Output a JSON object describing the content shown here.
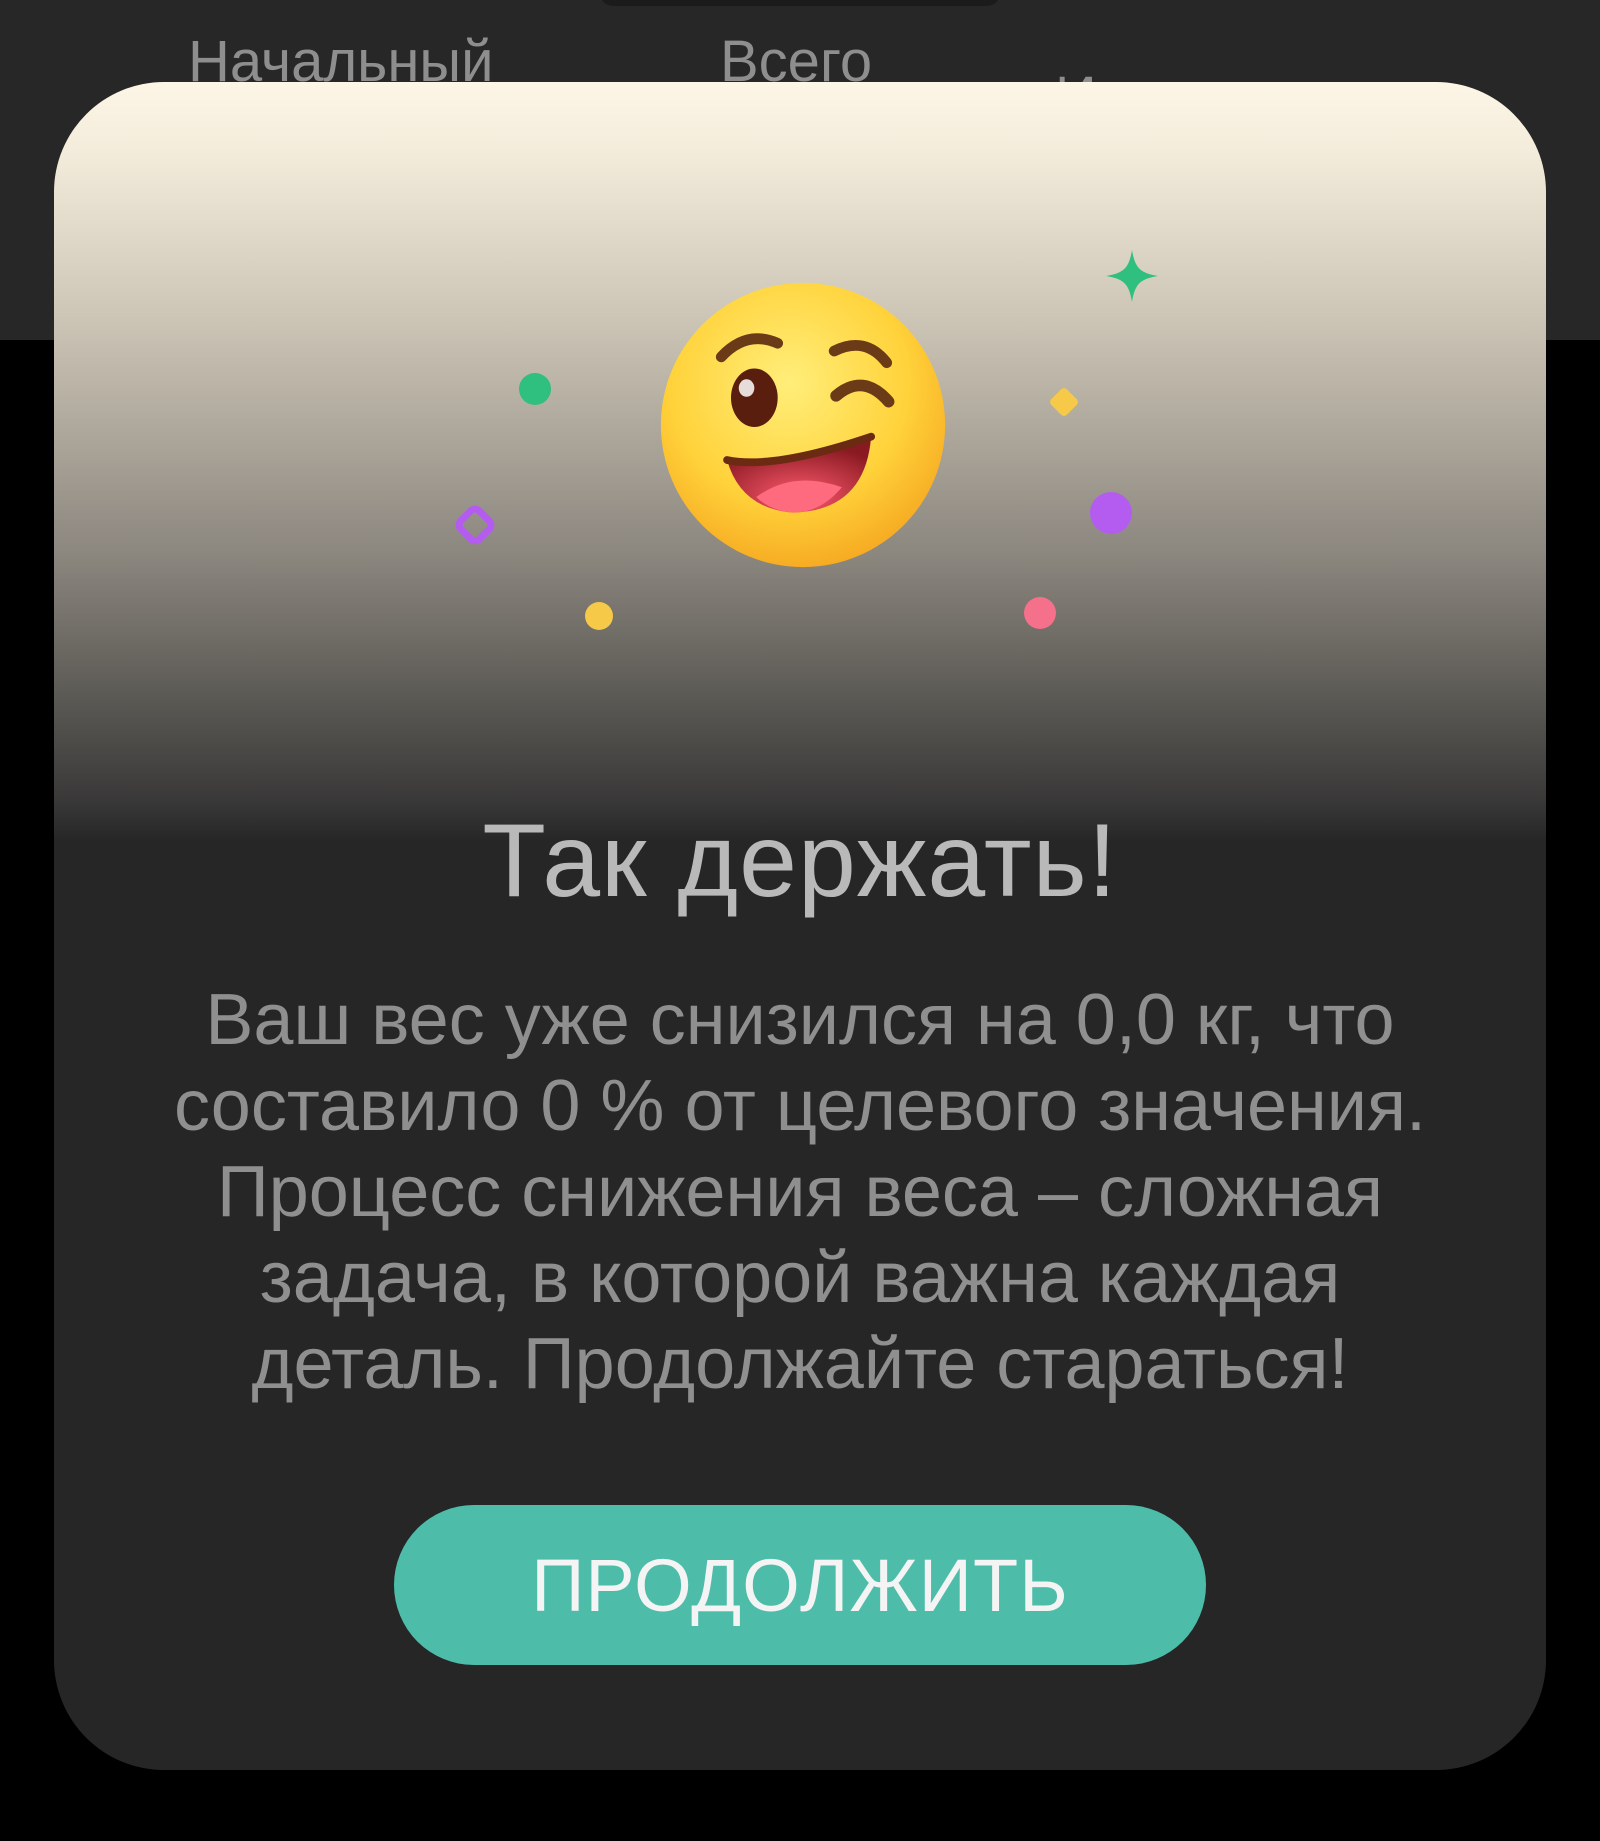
{
  "background": {
    "stat_labels": [
      "Начальный",
      "Всего",
      "Изменение"
    ]
  },
  "dialog": {
    "title": "Так держать!",
    "message": "Ваш вес уже снизился на 0,0 кг, что составило 0 % от целевого значения. Процесс снижения веса – сложная задача, в которой важна каждая деталь. Продолжайте стараться!",
    "continue_label": "ПРОДОЛЖИТЬ",
    "emoji": "winking-face-icon"
  },
  "colors": {
    "accent": "#4dbdaa",
    "dialog_bg": "#262626",
    "confetti_green": "#2fbf7e",
    "confetti_yellow": "#f7c948",
    "confetti_purple": "#b45cf0",
    "confetti_pink": "#f5708a"
  }
}
